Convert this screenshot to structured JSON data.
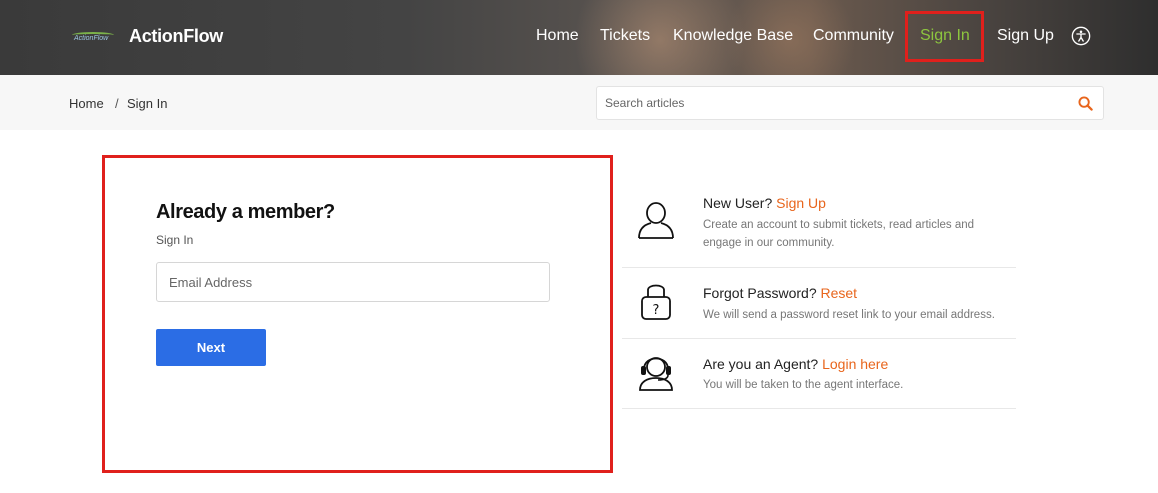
{
  "header": {
    "logo_text": "ActionFlow",
    "brand": "ActionFlow",
    "nav": [
      "Home",
      "Tickets",
      "Knowledge Base",
      "Community",
      "Sign In",
      "Sign Up"
    ],
    "accessibility_icon": "accessibility-icon"
  },
  "breadcrumb": {
    "home": "Home",
    "separator": "/",
    "current": "Sign In"
  },
  "search": {
    "placeholder": "Search articles",
    "value": ""
  },
  "signin": {
    "heading": "Already a member?",
    "subheading": "Sign In",
    "email_placeholder": "Email Address",
    "email_value": "",
    "next_label": "Next"
  },
  "options": [
    {
      "icon": "user-icon",
      "prefix": "New User?",
      "link": "Sign Up",
      "description": "Create an account to submit tickets, read articles and engage in our community."
    },
    {
      "icon": "lock-icon",
      "prefix": "Forgot Password?",
      "link": "Reset",
      "description": "We will send a password reset link to your email address."
    },
    {
      "icon": "headset-icon",
      "prefix": "Are you an Agent?",
      "link": "Login here",
      "description": "You will be taken to the agent interface."
    }
  ],
  "colors": {
    "accent_orange": "#e8651c",
    "nav_active": "#8dc63f",
    "button_blue": "#2b6de5",
    "highlight_red": "#e0201c"
  }
}
